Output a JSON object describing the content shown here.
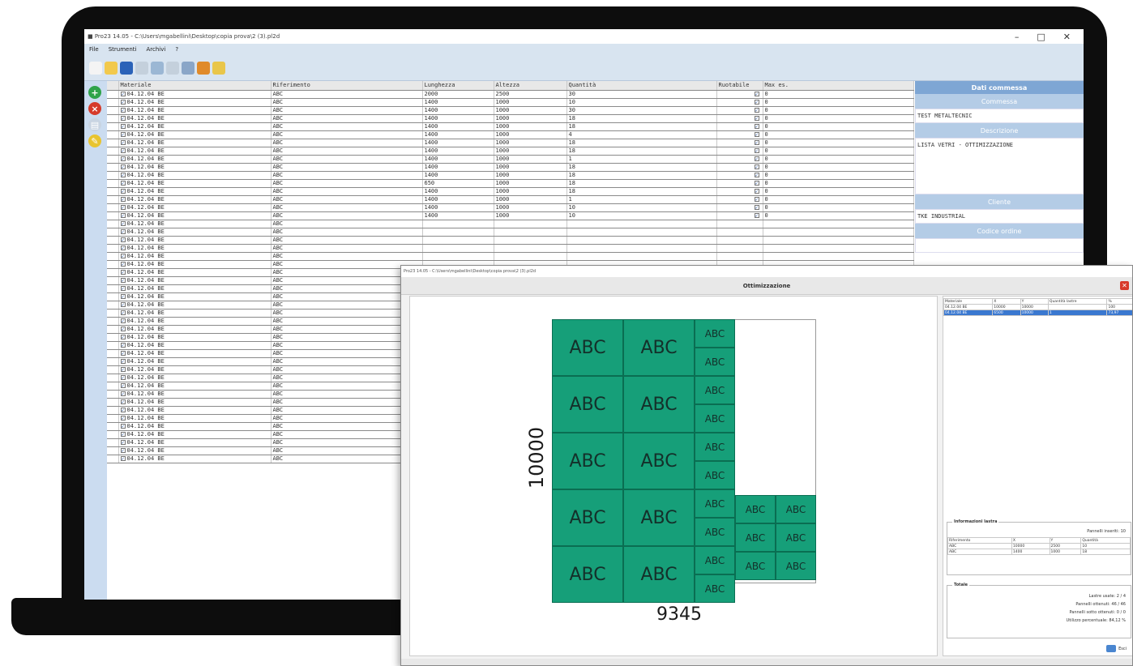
{
  "window": {
    "title": "■ Pro23 14.05 - C:\\Users\\mgabellini\\Desktop\\copia prova\\2 (3).pl2d",
    "controls": [
      "–",
      "□",
      "✕"
    ]
  },
  "menu": {
    "items": [
      "File",
      "Strumenti",
      "Archivi",
      "?"
    ]
  },
  "toolbar": {
    "icons": [
      "new-icon",
      "open-folder-icon",
      "save-icon",
      "print-icon",
      "globe-icon",
      "search-icon",
      "chart-icon",
      "gear-icon",
      "export-icon"
    ],
    "colors": [
      "#f4f4f4",
      "#f2c94c",
      "#2a62b8",
      "#c4d0dc",
      "#9bb7d4",
      "#c4d0dc",
      "#8aa6c8",
      "#e08a2a",
      "#e9c64a"
    ]
  },
  "side_buttons": [
    {
      "icon": "add-icon",
      "glyph": "+",
      "color": "#2fa34a"
    },
    {
      "icon": "delete-icon",
      "glyph": "×",
      "color": "#d63a2a"
    },
    {
      "icon": "document-icon",
      "glyph": "▤",
      "color": "#c8d4e2"
    },
    {
      "icon": "edit-icon",
      "glyph": "✎",
      "color": "#e8c430"
    }
  ],
  "grid": {
    "columns": [
      "Materiale",
      "Riferimento",
      "Lunghezza",
      "Altezza",
      "Quantità",
      "Ruotabile",
      "Max es."
    ],
    "rows": [
      [
        "04.12.04 BE",
        "ABC",
        "2000",
        "2500",
        "30",
        "0"
      ],
      [
        "04.12.04 BE",
        "ABC",
        "1400",
        "1000",
        "10",
        "0"
      ],
      [
        "04.12.04 BE",
        "ABC",
        "1400",
        "1000",
        "30",
        "0"
      ],
      [
        "04.12.04 BE",
        "ABC",
        "1400",
        "1000",
        "18",
        "0"
      ],
      [
        "04.12.04 BE",
        "ABC",
        "1400",
        "1000",
        "18",
        "0"
      ],
      [
        "04.12.04 BE",
        "ABC",
        "1400",
        "1000",
        "4",
        "0"
      ],
      [
        "04.12.04 BE",
        "ABC",
        "1400",
        "1000",
        "18",
        "0"
      ],
      [
        "04.12.04 BE",
        "ABC",
        "1400",
        "1000",
        "18",
        "0"
      ],
      [
        "04.12.04 BE",
        "ABC",
        "1400",
        "1000",
        "1",
        "0"
      ],
      [
        "04.12.04 BE",
        "ABC",
        "1400",
        "1000",
        "18",
        "0"
      ],
      [
        "04.12.04 BE",
        "ABC",
        "1400",
        "1000",
        "18",
        "0"
      ],
      [
        "04.12.04 BE",
        "ABC",
        "650",
        "1000",
        "18",
        "0"
      ],
      [
        "04.12.04 BE",
        "ABC",
        "1400",
        "1000",
        "18",
        "0"
      ],
      [
        "04.12.04 BE",
        "ABC",
        "1400",
        "1000",
        "1",
        "0"
      ],
      [
        "04.12.04 BE",
        "ABC",
        "1400",
        "1000",
        "10",
        "0"
      ],
      [
        "04.12.04 BE",
        "ABC",
        "1400",
        "1000",
        "10",
        "0"
      ],
      [
        "04.12.04 BE",
        "ABC",
        "",
        "",
        "",
        ""
      ],
      [
        "04.12.04 BE",
        "ABC",
        "",
        "",
        "",
        ""
      ],
      [
        "04.12.04 BE",
        "ABC",
        "",
        "",
        "",
        ""
      ],
      [
        "04.12.04 BE",
        "ABC",
        "",
        "",
        "",
        ""
      ],
      [
        "04.12.04 BE",
        "ABC",
        "",
        "",
        "",
        ""
      ],
      [
        "04.12.04 BE",
        "ABC",
        "",
        "",
        "",
        ""
      ],
      [
        "04.12.04 BE",
        "ABC",
        "",
        "",
        "",
        ""
      ],
      [
        "04.12.04 BE",
        "ABC",
        "",
        "",
        "",
        ""
      ],
      [
        "04.12.04 BE",
        "ABC",
        "",
        "",
        "",
        ""
      ],
      [
        "04.12.04 BE",
        "ABC",
        "",
        "",
        "",
        ""
      ],
      [
        "04.12.04 BE",
        "ABC",
        "",
        "",
        "",
        ""
      ],
      [
        "04.12.04 BE",
        "ABC",
        "",
        "",
        "",
        ""
      ],
      [
        "04.12.04 BE",
        "ABC",
        "",
        "",
        "",
        ""
      ],
      [
        "04.12.04 BE",
        "ABC",
        "",
        "",
        "",
        ""
      ],
      [
        "04.12.04 BE",
        "ABC",
        "",
        "",
        "",
        ""
      ],
      [
        "04.12.04 BE",
        "ABC",
        "",
        "",
        "",
        ""
      ],
      [
        "04.12.04 BE",
        "ABC",
        "",
        "",
        "",
        ""
      ],
      [
        "04.12.04 BE",
        "ABC",
        "",
        "",
        "",
        ""
      ],
      [
        "04.12.04 BE",
        "ABC",
        "",
        "",
        "",
        ""
      ],
      [
        "04.12.04 BE",
        "ABC",
        "",
        "",
        "",
        ""
      ],
      [
        "04.12.04 BE",
        "ABC",
        "",
        "",
        "",
        ""
      ],
      [
        "04.12.04 BE",
        "ABC",
        "",
        "",
        "",
        ""
      ],
      [
        "04.12.04 BE",
        "ABC",
        "",
        "",
        "",
        ""
      ],
      [
        "04.12.04 BE",
        "ABC",
        "",
        "",
        "",
        ""
      ],
      [
        "04.12.04 BE",
        "ABC",
        "",
        "",
        "",
        ""
      ],
      [
        "04.12.04 BE",
        "ABC",
        "",
        "",
        "",
        ""
      ],
      [
        "04.12.04 BE",
        "ABC",
        "",
        "",
        "",
        ""
      ],
      [
        "04.12.04 BE",
        "ABC",
        "",
        "",
        "",
        ""
      ],
      [
        "04.12.04 BE",
        "ABC",
        "",
        "",
        "",
        ""
      ],
      [
        "04.12.04 BE",
        "ABC",
        "",
        "",
        "",
        ""
      ]
    ]
  },
  "commessa": {
    "header": "Dati commessa",
    "commessa_label": "Commessa",
    "commessa_value": "TEST METALTECNIC",
    "descrizione_label": "Descrizione",
    "descrizione_value": "LISTA VETRI - OTTIMIZZAZIONE",
    "cliente_label": "Cliente",
    "cliente_value": "TKE INDUSTRIAL",
    "codice_label": "Codice ordine"
  },
  "optimization": {
    "title": "Ottimizzazione",
    "titlebar": "Pro23 14.05 - C:\\Users\\mgabellini\\Desktop\\copia prova\\2 (3).pl2d",
    "sheet_height": "10000",
    "sheet_width": "9345",
    "piece_label": "ABC",
    "piece_color": "#169f79",
    "sheets_table": {
      "columns": [
        "Materiale",
        "X",
        "Y",
        "Quantità lastre",
        "%"
      ],
      "rows": [
        [
          "04.12.04 BE",
          "10000",
          "10000",
          "",
          "100"
        ],
        [
          "04.12.04 BE",
          "6500",
          "10000",
          "1",
          "73,97"
        ]
      ]
    },
    "info_lastra": {
      "title": "Informazioni lastra",
      "pieces_label": "Pannelli inseriti: 10",
      "columns": [
        "Riferimento",
        "X",
        "Y",
        "Quantità"
      ],
      "rows": [
        [
          "ABC",
          "10000",
          "2500",
          "10"
        ],
        [
          "ABC",
          "1400",
          "1000",
          "18"
        ]
      ]
    },
    "totale": {
      "title": "Totale",
      "lines": [
        "Lastre usate: 2 / 4",
        "Pannelli ottenuti: 46 / 46",
        "Pannelli sotto ottenuti: 0 / 0",
        "Utilizzo percentuale: 84,12 %"
      ]
    },
    "exit_label": "Esci"
  }
}
